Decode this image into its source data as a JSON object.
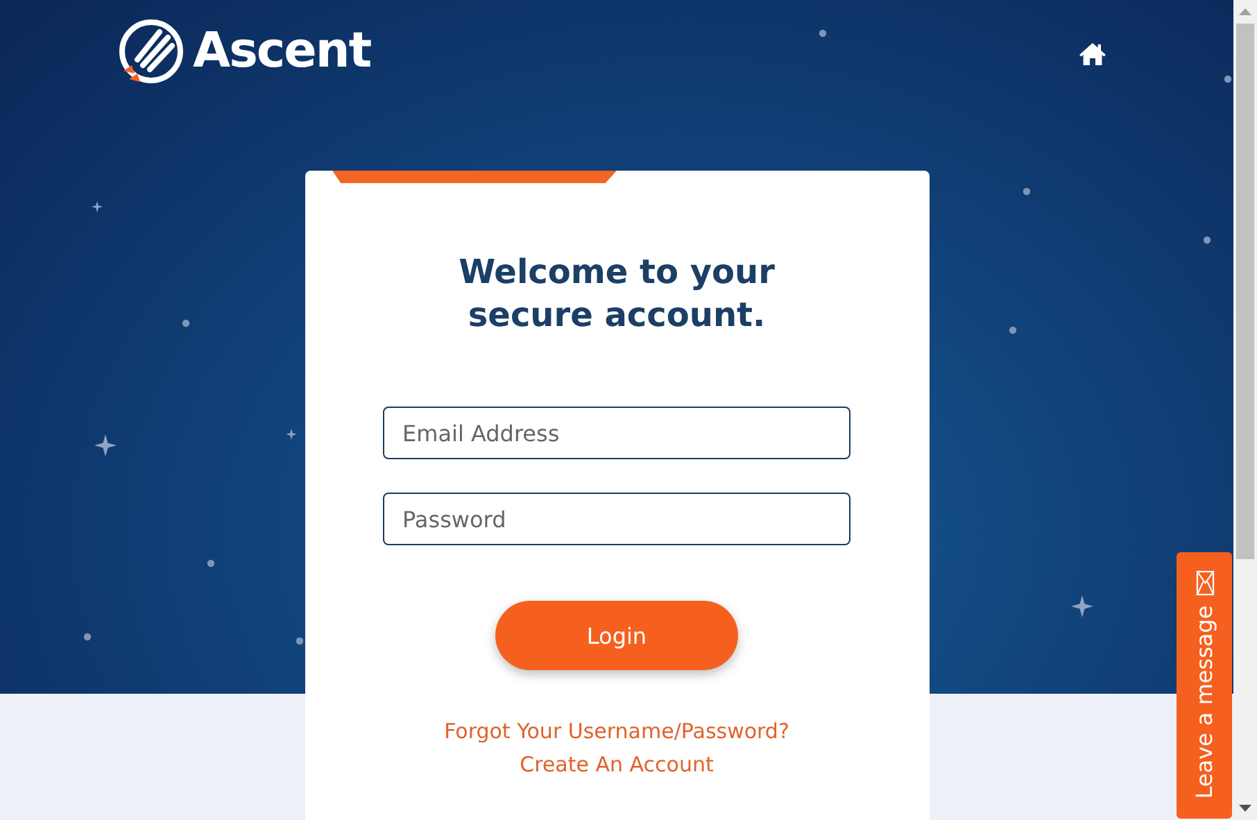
{
  "header": {
    "logo": "Ascent"
  },
  "card": {
    "title": "Welcome to your secure account.",
    "fields": [
      {
        "placeholder": "Email Address"
      },
      {
        "placeholder": "Password"
      }
    ],
    "button": "Login",
    "links": [
      "Forgot Your Username/Password?",
      "Create An Account"
    ]
  },
  "chat_tab": {
    "label": "Leave a message"
  }
}
